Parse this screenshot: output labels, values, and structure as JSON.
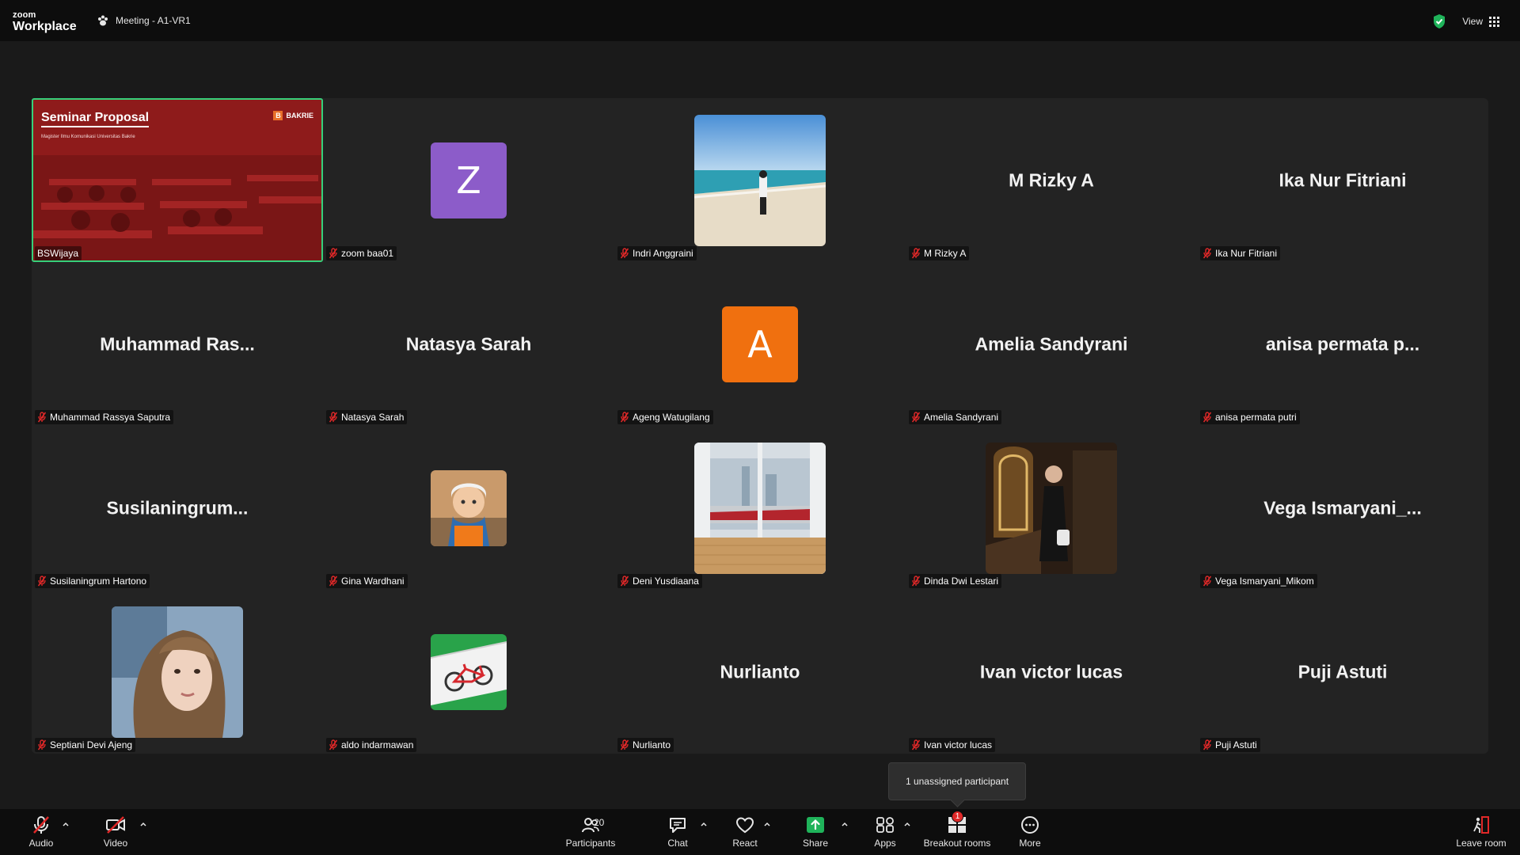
{
  "app": {
    "logo_top": "zoom",
    "logo_bottom": "Workplace",
    "meeting_title": "Meeting - A1-VR1",
    "view_label": "View"
  },
  "share": {
    "title": "Seminar Proposal",
    "subtitle": "Magister Ilmu Komunikasi Universitas Bakrie",
    "brand": "BAKRIE",
    "brand_letter": "B"
  },
  "participants": [
    {
      "label": "BSWijaya",
      "big": "",
      "kind": "share",
      "muted": false
    },
    {
      "label": "zoom baa01",
      "big": "",
      "kind": "letter",
      "letter": "Z",
      "color": "#8c5cc9",
      "muted": true
    },
    {
      "label": "Indri Anggraini",
      "big": "",
      "kind": "photo-beach",
      "muted": true
    },
    {
      "label": "M Rizky A",
      "big": "M Rizky A",
      "kind": "name",
      "muted": true
    },
    {
      "label": "Ika Nur Fitriani",
      "big": "Ika Nur Fitriani",
      "kind": "name",
      "muted": true
    },
    {
      "label": "Muhammad Rassya Saputra",
      "big": "Muhammad  Ras...",
      "kind": "name",
      "muted": true
    },
    {
      "label": "Natasya Sarah",
      "big": "Natasya Sarah",
      "kind": "name",
      "muted": true
    },
    {
      "label": "Ageng Watugilang",
      "big": "",
      "kind": "letter",
      "letter": "A",
      "color": "#f0700f",
      "muted": true
    },
    {
      "label": "Amelia Sandyrani",
      "big": "Amelia Sandyrani",
      "kind": "name",
      "muted": true
    },
    {
      "label": "anisa permata putri",
      "big": "anisa  permata  p...",
      "kind": "name",
      "muted": true
    },
    {
      "label": "Susilaningrum Hartono",
      "big": "Susilaningrum...",
      "kind": "name",
      "muted": true
    },
    {
      "label": "Gina Wardhani",
      "big": "",
      "kind": "photo-cartoon",
      "muted": true
    },
    {
      "label": "Deni Yusdiaana",
      "big": "",
      "kind": "photo-train",
      "muted": true
    },
    {
      "label": "Dinda Dwi Lestari",
      "big": "",
      "kind": "photo-dinda",
      "muted": true
    },
    {
      "label": "Vega Ismaryani_Mikom",
      "big": "Vega  Ismaryani_...",
      "kind": "name",
      "muted": true
    },
    {
      "label": "Septiani Devi Ajeng",
      "big": "",
      "kind": "photo-septiani",
      "muted": true
    },
    {
      "label": "aldo indarmawan",
      "big": "",
      "kind": "photo-bike",
      "muted": true
    },
    {
      "label": "Nurlianto",
      "big": "Nurlianto",
      "kind": "name",
      "muted": true
    },
    {
      "label": "Ivan victor lucas",
      "big": "Ivan victor lucas",
      "kind": "name",
      "muted": true
    },
    {
      "label": "Puji Astuti",
      "big": "Puji Astuti",
      "kind": "name",
      "muted": true
    }
  ],
  "tooltip": "1 unassigned participant",
  "toolbar": {
    "audio": "Audio",
    "video": "Video",
    "participants": "Participants",
    "participants_count": "20",
    "chat": "Chat",
    "react": "React",
    "share": "Share",
    "apps": "Apps",
    "breakout": "Breakout rooms",
    "breakout_badge": "1",
    "more": "More",
    "leave": "Leave room"
  },
  "colors": {
    "accent_green": "#36d07a",
    "share_green": "#1fb35a",
    "muted_red": "#e02828",
    "leave_red": "#e02828"
  }
}
